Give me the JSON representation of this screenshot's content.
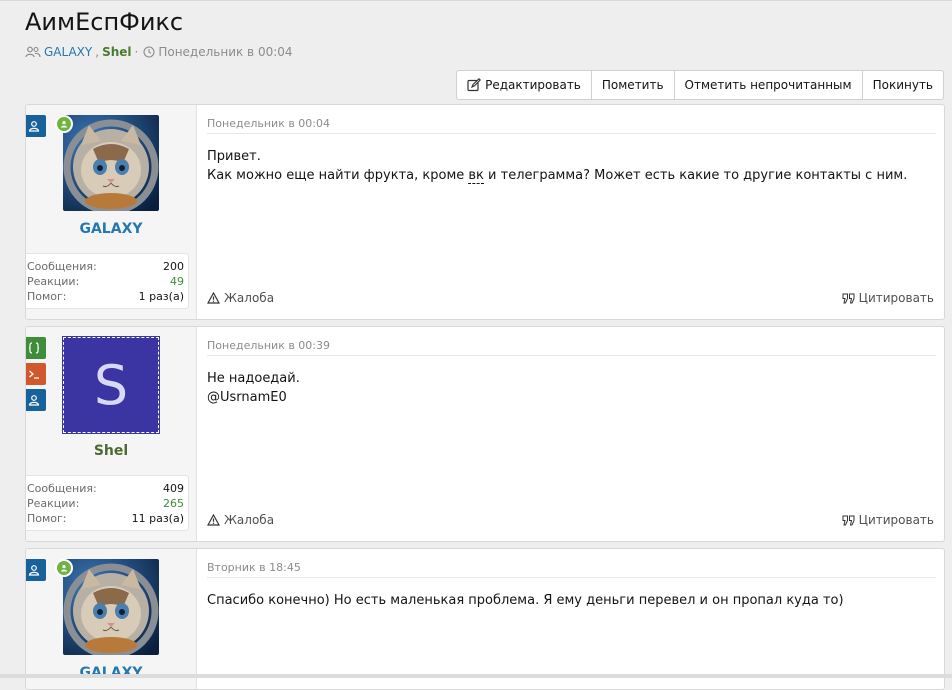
{
  "thread": {
    "title": "АимЕспФикс",
    "participant_1": "GALAXY",
    "separator": ",",
    "participant_2": "Shel",
    "dot": "·",
    "started": "Понедельник в 00:04"
  },
  "actions": [
    {
      "label": "Редактировать",
      "icon": "edit-icon"
    },
    {
      "label": "Пометить"
    },
    {
      "label": "Отметить непрочитанным"
    },
    {
      "label": "Покинуть"
    }
  ],
  "colors": {
    "accent_blue": "#2577b1",
    "username_green": "#4b6b2f",
    "badge_blue": "#17629a",
    "badge_green": "#3f8c3a",
    "badge_orange": "#d0582c",
    "avatar_purple": "#3a35a2"
  },
  "posts": [
    {
      "author": "GALAXY",
      "avatar_letter": "",
      "online": true,
      "stats_labels": [
        "Сообщения:",
        "Реакции:",
        "Помог:"
      ],
      "stats_values": [
        "200",
        "49",
        "1 раз(а)"
      ],
      "date": "Понедельник в 00:04",
      "body_line1": "Привет.",
      "body_line2_a": "Как можно еще найти фрукта, кроме ",
      "body_line2_abbr": "вк",
      "body_line2_b": " и телеграмма? Может есть какие то другие контакты с ним.",
      "report": "Жалоба",
      "quote": "Цитировать"
    },
    {
      "author": "Shel",
      "avatar_letter": "S",
      "online": false,
      "stats_labels": [
        "Сообщения:",
        "Реакции:",
        "Помог:"
      ],
      "stats_values": [
        "409",
        "265",
        "11 раз(а)"
      ],
      "date": "Понедельник в 00:39",
      "body_line1": "Не надоедай.",
      "body_line2": "@UsrnamE0",
      "report": "Жалоба",
      "quote": "Цитировать"
    },
    {
      "author": "GALAXY",
      "online": true,
      "date": "Вторник в 18:45",
      "body_line1": "Спасибо конечно) Но есть маленькая проблема. Я ему деньги перевел и он пропал куда то)"
    }
  ]
}
